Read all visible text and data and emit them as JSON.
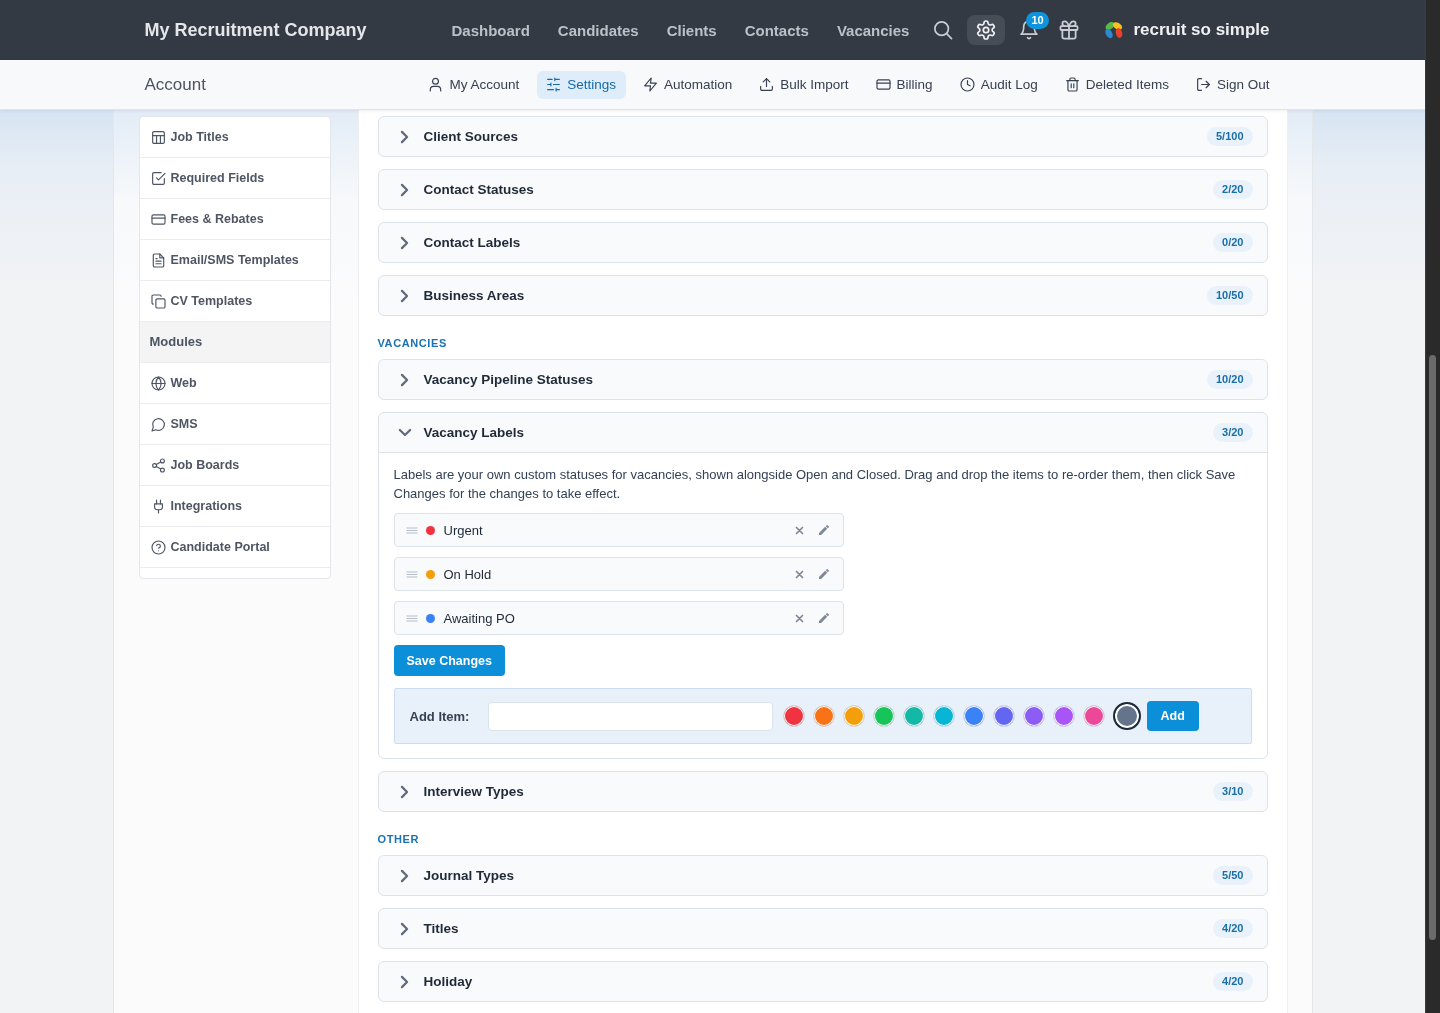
{
  "top_nav": {
    "company": "My Recruitment Company",
    "links": [
      {
        "label": "Dashboard",
        "selected": false
      },
      {
        "label": "Candidates",
        "selected": false
      },
      {
        "label": "Clients",
        "selected": false
      },
      {
        "label": "Contacts",
        "selected": false
      },
      {
        "label": "Vacancies",
        "selected": false
      }
    ],
    "icon_buttons": [
      {
        "kind": "search",
        "selected": false
      },
      {
        "kind": "settings",
        "selected": true
      },
      {
        "kind": "notifications",
        "selected": false,
        "badge": "10"
      },
      {
        "kind": "gift",
        "selected": false
      }
    ],
    "brand": "recruit so simple"
  },
  "sub_nav": {
    "title": "Account",
    "items": [
      {
        "label": "My Account",
        "selected": false
      },
      {
        "label": "Settings",
        "selected": true
      },
      {
        "label": "Automation",
        "selected": false
      },
      {
        "label": "Bulk Import",
        "selected": false
      },
      {
        "label": "Billing",
        "selected": false
      },
      {
        "label": "Audit Log",
        "selected": false
      },
      {
        "label": "Deleted Items",
        "selected": false
      },
      {
        "label": "Sign Out",
        "selected": false
      }
    ]
  },
  "sidebar": {
    "items": [
      {
        "kind": "item",
        "label": "Job Titles",
        "selected": false
      },
      {
        "kind": "item",
        "label": "Required Fields",
        "selected": false
      },
      {
        "kind": "item",
        "label": "Fees & Rebates",
        "selected": false
      },
      {
        "kind": "item",
        "label": "Email/SMS Templates",
        "selected": false
      },
      {
        "kind": "item",
        "label": "CV Templates",
        "selected": false
      },
      {
        "kind": "heading",
        "label": "Modules"
      },
      {
        "kind": "item",
        "label": "Web",
        "selected": false
      },
      {
        "kind": "item",
        "label": "SMS",
        "selected": false
      },
      {
        "kind": "item",
        "label": "Job Boards",
        "selected": false
      },
      {
        "kind": "item",
        "label": "Integrations",
        "selected": false
      },
      {
        "kind": "item",
        "label": "Candidate Portal",
        "selected": false
      }
    ]
  },
  "groups": [
    {
      "rows": [
        {
          "title": "Client Sources",
          "count": "5/100",
          "expanded": false
        },
        {
          "title": "Contact Statuses",
          "count": "2/20",
          "expanded": false
        },
        {
          "title": "Contact Labels",
          "count": "0/20",
          "expanded": false
        },
        {
          "title": "Business Areas",
          "count": "10/50",
          "expanded": false
        }
      ]
    },
    {
      "heading": "VACANCIES",
      "rows": [
        {
          "title": "Vacancy Pipeline Statuses",
          "count": "10/20",
          "expanded": false
        },
        {
          "title": "Vacancy Labels",
          "count": "3/20",
          "expanded": true,
          "description": "Labels are your own custom statuses for vacancies, shown alongside Open and Closed. Drag and drop the items to re-order them, then click Save Changes for the changes to take effect.",
          "items": [
            {
              "label": "Urgent",
              "color": "#ef3340"
            },
            {
              "label": "On Hold",
              "color": "#f59e0b"
            },
            {
              "label": "Awaiting PO",
              "color": "#3b82f6"
            }
          ],
          "save_button": "Save Changes",
          "add_item": {
            "label": "Add Item:",
            "swatches": [
              {
                "color": "#ef3340",
                "selected": false
              },
              {
                "color": "#f97316",
                "selected": false
              },
              {
                "color": "#f59e0b",
                "selected": false
              },
              {
                "color": "#16c45a",
                "selected": false
              },
              {
                "color": "#14b8a6",
                "selected": false
              },
              {
                "color": "#06b6d4",
                "selected": false
              },
              {
                "color": "#3b82f6",
                "selected": false
              },
              {
                "color": "#6366f1",
                "selected": false
              },
              {
                "color": "#8b5cf6",
                "selected": false
              },
              {
                "color": "#a855f7",
                "selected": false
              },
              {
                "color": "#ec4899",
                "selected": false
              },
              {
                "color": "#64748b",
                "selected": true
              }
            ],
            "button": "Add"
          }
        },
        {
          "title": "Interview Types",
          "count": "3/10",
          "expanded": false
        }
      ]
    },
    {
      "heading": "OTHER",
      "rows": [
        {
          "title": "Journal Types",
          "count": "5/50",
          "expanded": false
        },
        {
          "title": "Titles",
          "count": "4/20",
          "expanded": false
        },
        {
          "title": "Holiday",
          "count": "4/20",
          "expanded": false
        }
      ]
    }
  ]
}
